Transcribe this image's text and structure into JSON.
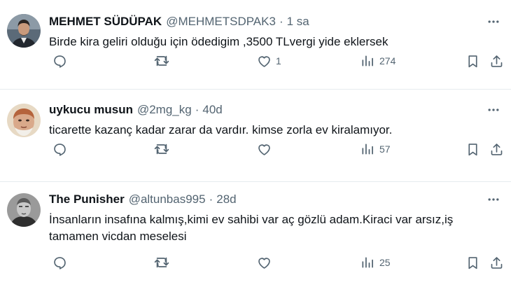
{
  "tweets": [
    {
      "name": "MEHMET SÜDÜPAK",
      "handle": "@MEHMETSDPAK3",
      "separator": "·",
      "time": "1 sa",
      "text": "Birde kira geliri olduğu için ödedigim ,3500 TLvergi yide eklersek",
      "likes": "1",
      "views": "274",
      "avatar": "avatar-man-suit"
    },
    {
      "name": "uykucu musun",
      "handle": "@2mg_kg",
      "separator": "·",
      "time": "40d",
      "text": "ticarette kazanç kadar zarar da vardır. kimse zorla ev kiralamıyor.",
      "views": "57",
      "avatar": "avatar-painting-face"
    },
    {
      "name": "The Punisher",
      "handle": "@altunbas995",
      "separator": "·",
      "time": "28d",
      "text": "İnsanların insafına kalmış,kimi ev sahibi var aç gözlü adam.Kiraci var arsız,iş tamamen vicdan meselesi",
      "views": "25",
      "avatar": "avatar-bw-portrait"
    }
  ],
  "colors": {
    "text": "#0f1419",
    "secondary": "#536471",
    "divider": "#e6ebee"
  },
  "icons": [
    "more-icon",
    "reply-icon",
    "retweet-icon",
    "like-icon",
    "views-icon",
    "bookmark-icon",
    "share-icon"
  ]
}
